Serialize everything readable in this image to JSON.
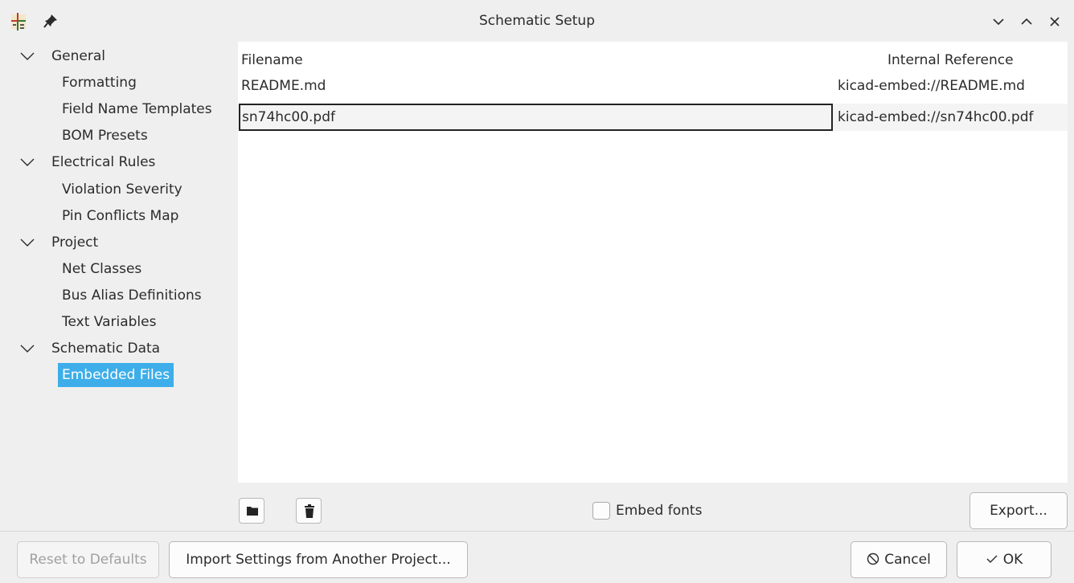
{
  "window": {
    "title": "Schematic Setup",
    "app_icon": "kicad-schematic-icon",
    "pin_icon": "pin-icon",
    "controls": [
      "minimize-icon",
      "maximize-icon",
      "close-icon"
    ]
  },
  "sidebar": {
    "items": [
      {
        "label": "General",
        "level": 0,
        "expanded": true
      },
      {
        "label": "Formatting",
        "level": 1
      },
      {
        "label": "Field Name Templates",
        "level": 1
      },
      {
        "label": "BOM Presets",
        "level": 1
      },
      {
        "label": "Electrical Rules",
        "level": 0,
        "expanded": true
      },
      {
        "label": "Violation Severity",
        "level": 1
      },
      {
        "label": "Pin Conflicts Map",
        "level": 1
      },
      {
        "label": "Project",
        "level": 0,
        "expanded": true
      },
      {
        "label": "Net Classes",
        "level": 1
      },
      {
        "label": "Bus Alias Definitions",
        "level": 1
      },
      {
        "label": "Text Variables",
        "level": 1
      },
      {
        "label": "Schematic Data",
        "level": 0,
        "expanded": true
      },
      {
        "label": "Embedded Files",
        "level": 1,
        "selected": true
      }
    ]
  },
  "table": {
    "columns": [
      "Filename",
      "Internal Reference"
    ],
    "rows": [
      {
        "filename": "README.md",
        "reference": "kicad-embed://README.md"
      },
      {
        "filename": "sn74hc00.pdf",
        "reference": "kicad-embed://sn74hc00.pdf",
        "focused": true
      }
    ]
  },
  "panel_toolbar": {
    "open_icon": "folder-icon",
    "delete_icon": "trash-icon",
    "embed_fonts_label": "Embed fonts",
    "embed_fonts_checked": false,
    "export_label": "Export..."
  },
  "footer": {
    "reset_label": "Reset to Defaults",
    "import_label": "Import Settings from Another Project...",
    "cancel_label": "Cancel",
    "ok_label": "OK"
  },
  "colors": {
    "selection": "#3daee9",
    "background": "#efefef",
    "panel": "#ffffff"
  }
}
